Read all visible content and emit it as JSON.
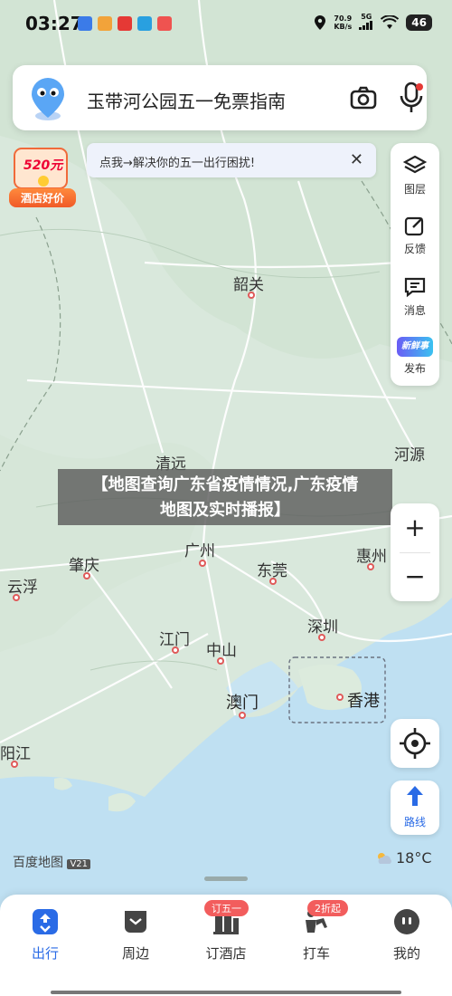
{
  "status": {
    "time": "03:27",
    "net_speed": "70.9",
    "net_unit": "KB/s",
    "signal": "5G",
    "battery": "46"
  },
  "search": {
    "placeholder": "玉带河公园五一免票指南"
  },
  "promo": {
    "badge_number": "520元",
    "badge_label": "酒店好价"
  },
  "notice": {
    "text": "点我→解决你的五一出行困扰!",
    "close": "✕"
  },
  "tools": {
    "layers": "图层",
    "feedback": "反馈",
    "messages": "消息",
    "publish": "发布",
    "publish_tag": "新鲜事"
  },
  "map": {
    "places": {
      "shaoguan": "韶关",
      "qingyuan": "清远",
      "heyuan": "河源",
      "guangzhou": "广州",
      "zhaoqing": "肇庆",
      "dongguan": "东莞",
      "huizhou": "惠州",
      "yunfu": "云浮",
      "jiangmen": "江门",
      "zhongshan": "中山",
      "shenzhen": "深圳",
      "macau": "澳门",
      "hongkong": "香港",
      "yangjiang": "阳江"
    },
    "brand": "百度地图",
    "brand_version": "V21",
    "weather": "18°C",
    "colors": {
      "land": "#d9e8dc",
      "water": "#bfe0f2",
      "road": "#ffffff",
      "accent": "#2a6be6"
    }
  },
  "controls": {
    "zoom_in": "+",
    "zoom_out": "−",
    "route": "路线"
  },
  "caption": {
    "line1": "【地图查询广东省疫情情况,广东疫情",
    "line2": "地图及实时播报】"
  },
  "nav": {
    "items": [
      {
        "label": "出行",
        "active": true
      },
      {
        "label": "周边"
      },
      {
        "label": "订酒店",
        "badge": "订五一"
      },
      {
        "label": "打车",
        "badge": "2折起"
      },
      {
        "label": "我的"
      }
    ]
  }
}
